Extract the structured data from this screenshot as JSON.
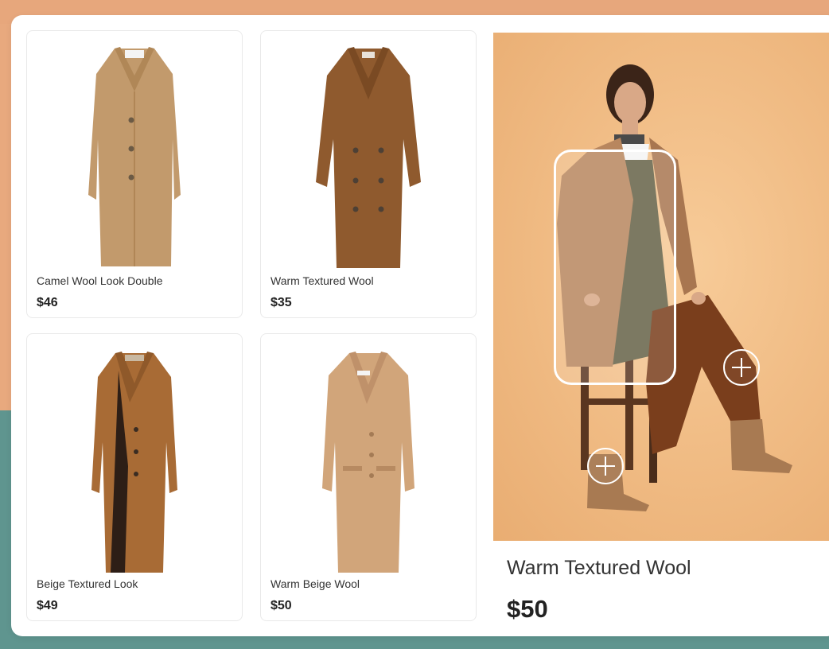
{
  "products": [
    {
      "name": "Camel Wool Look Double",
      "price": "$46",
      "icon": "coat-camel-single-breasted"
    },
    {
      "name": "Warm Textured Wool",
      "price": "$35",
      "icon": "coat-brown-double-breasted"
    },
    {
      "name": "Beige Textured Look",
      "price": "$49",
      "icon": "coat-tan-textured"
    },
    {
      "name": "Warm Beige Wool",
      "price": "$50",
      "icon": "coat-beige-wool"
    }
  ],
  "detail": {
    "title": "Warm Textured Wool",
    "price": "$50"
  },
  "colors": {
    "background": "#e8a97e",
    "teal": "#5f958f",
    "panel": "#ffffff"
  }
}
